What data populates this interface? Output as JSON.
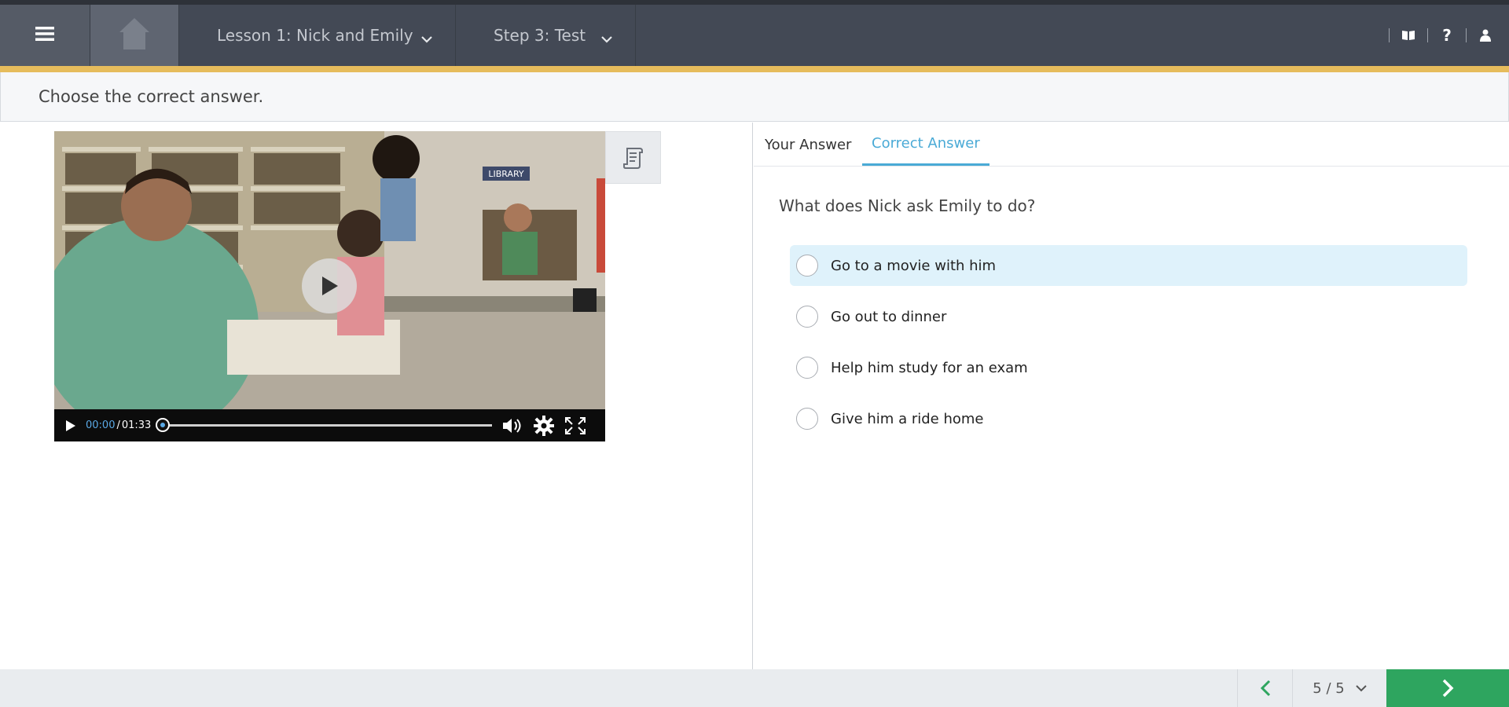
{
  "header": {
    "lesson_label": "Lesson 1: Nick and Emily",
    "step_label": "Step 3: Test",
    "help_glyph": "?",
    "icons": [
      "menu-icon",
      "home-icon",
      "chevron-down-icon",
      "book-icon",
      "help-icon",
      "user-icon"
    ]
  },
  "instruction": "Choose the correct answer.",
  "video": {
    "current_time": "00:00",
    "separator": "/",
    "total_time": "01:33",
    "progress": 0,
    "scene_sign": "LIBRARY"
  },
  "tabs": [
    {
      "label": "Your Answer",
      "active": false
    },
    {
      "label": "Correct Answer",
      "active": true
    }
  ],
  "question": "What does Nick ask Emily to do?",
  "options": [
    {
      "label": "Go to a movie with him",
      "selected": true
    },
    {
      "label": "Go out to dinner",
      "selected": false
    },
    {
      "label": "Help him study for an exam",
      "selected": false
    },
    {
      "label": "Give him a ride home",
      "selected": false
    }
  ],
  "pagination": {
    "label": "5 / 5"
  },
  "colors": {
    "topbar": "#434955",
    "accent_stripe": "#e6bc5c",
    "tab_active": "#4aaad6",
    "selected_option": "#dff2fb",
    "next_button": "#2ea55f"
  }
}
